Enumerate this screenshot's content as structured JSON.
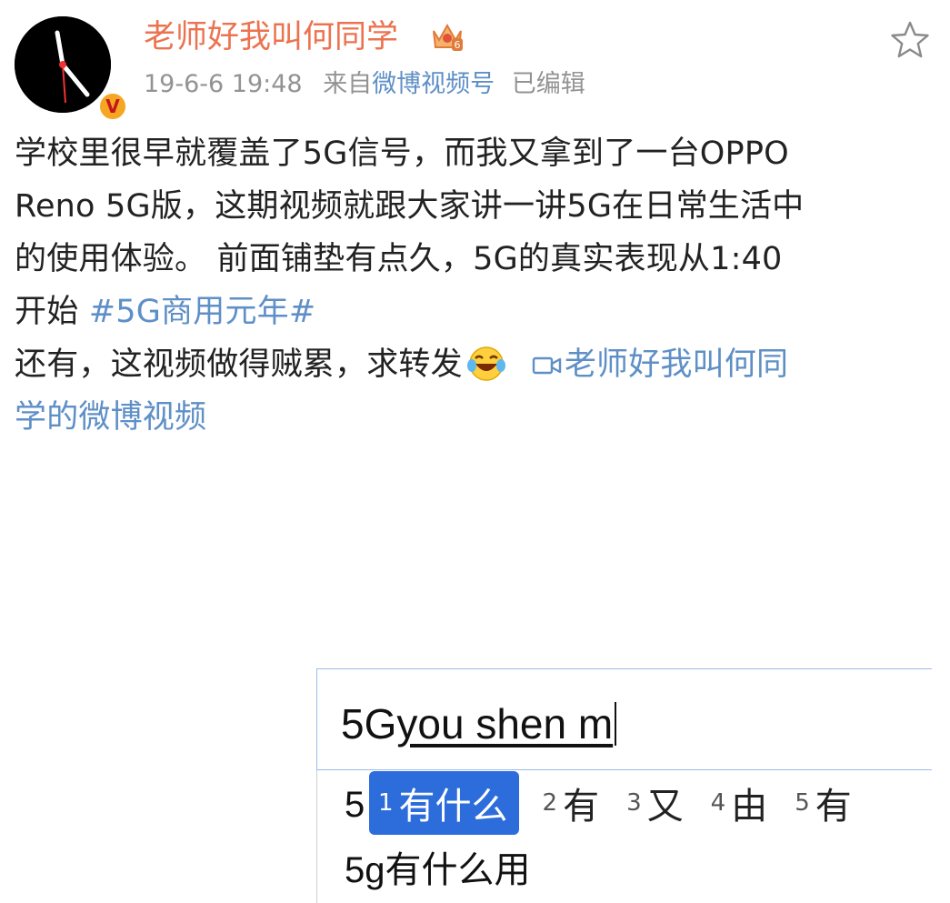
{
  "user": {
    "name": "老师好我叫何同学",
    "verified_badge": "V",
    "vip_crown": "crown-6-icon"
  },
  "meta": {
    "date": "19-6-6 19:48",
    "from_prefix": "来自",
    "source": "微博视频号",
    "edited": "已编辑"
  },
  "post": {
    "line1": "学校里很早就覆盖了5G信号，而我又拿到了一台OPPO",
    "line2": "Reno 5G版，这期视频就跟大家讲一讲5G在日常生活中",
    "line3": "的使用体验。 前面铺垫有点久，5G的真实表现从1:40",
    "line4_prefix": "开始 ",
    "hashtag": "#5G商用元年#",
    "line5": "还有，这视频做得贼累，求转发",
    "video_link_line1": "老师好我叫何同",
    "video_link_line2": "学的微博视频"
  },
  "embedded": {
    "typed_prefix": "5G",
    "typed_pinyin": "you shen m",
    "suggestion1_prefix": "5",
    "suggestion2": "5g有什么用",
    "ime_candidates": [
      {
        "num": "1",
        "text": "有什么"
      },
      {
        "num": "2",
        "text": "有"
      },
      {
        "num": "3",
        "text": "又"
      },
      {
        "num": "4",
        "text": "由"
      },
      {
        "num": "5",
        "text": "有"
      }
    ]
  },
  "colors": {
    "username": "#eb7350",
    "link": "#5e8fc6",
    "meta": "#939393",
    "ime_selected": "#2c6ddb"
  }
}
